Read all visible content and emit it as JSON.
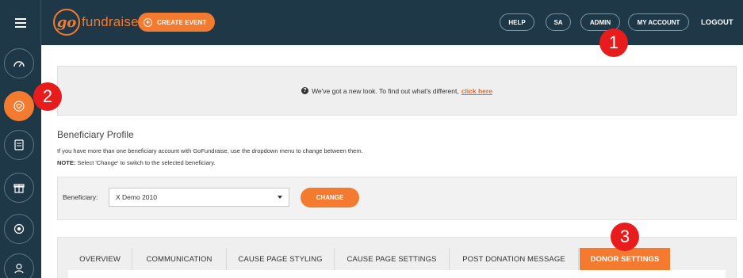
{
  "header": {
    "logo_mark": "go",
    "logo_text": "fundraise",
    "create_event_label": "CREATE EVENT",
    "nav": [
      {
        "label": "HELP"
      },
      {
        "label": "SA"
      },
      {
        "label": "ADMIN"
      },
      {
        "label": "MY ACCOUNT"
      }
    ],
    "logout_label": "LOGOUT"
  },
  "sidebar": {
    "items": [
      {
        "icon": "dashboard-icon"
      },
      {
        "icon": "heart-icon",
        "active": true
      },
      {
        "icon": "document-icon"
      },
      {
        "icon": "gift-icon"
      },
      {
        "icon": "target-icon"
      },
      {
        "icon": "user-icon"
      }
    ]
  },
  "badges": [
    "1",
    "2",
    "3"
  ],
  "notice": {
    "icon": "question-circle-icon",
    "text": "We've got a new look. To find out what's different,",
    "link_text": "click here"
  },
  "beneficiary_profile": {
    "title": "Beneficiary Profile",
    "description": "If you have more than one beneficiary account with GoFundraise, use the dropdown menu to change between them.",
    "note_label": "NOTE:",
    "note_text": " Select 'Change' to switch to the selected beneficiary.",
    "field_label": "Beneficiary:",
    "selected_value": "X Demo 2010",
    "change_label": "CHANGE"
  },
  "tabs": [
    {
      "label": "OVERVIEW"
    },
    {
      "label": "COMMUNICATION"
    },
    {
      "label": "CAUSE PAGE STYLING"
    },
    {
      "label": "CAUSE PAGE SETTINGS"
    },
    {
      "label": "POST DONATION MESSAGE"
    },
    {
      "label": "DONOR SETTINGS",
      "active": true
    }
  ],
  "colors": {
    "header_bg": "#1f3847",
    "accent": "#f47a2f",
    "badge": "#e81c1c"
  }
}
